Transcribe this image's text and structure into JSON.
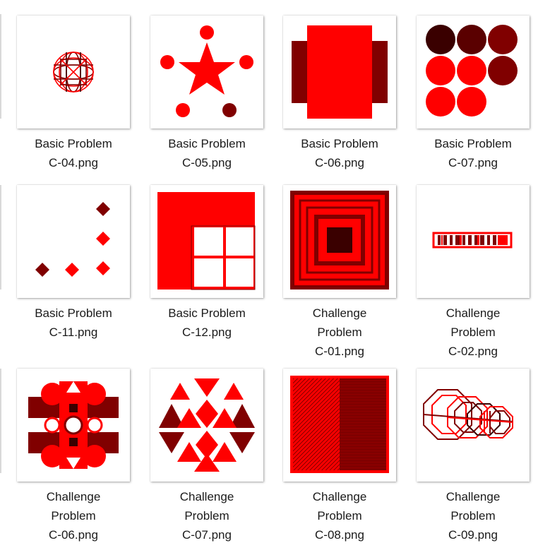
{
  "files": [
    {
      "line1": "Basic Problem",
      "line2": "C-04.png",
      "line3": "",
      "icon": "sphere-grid-image"
    },
    {
      "line1": "Basic Problem",
      "line2": "C-05.png",
      "line3": "",
      "icon": "star-circles-image"
    },
    {
      "line1": "Basic Problem",
      "line2": "C-06.png",
      "line3": "",
      "icon": "rectangles-image"
    },
    {
      "line1": "Basic Problem",
      "line2": "C-07.png",
      "line3": "",
      "icon": "circles-grid-image"
    },
    {
      "line1": "Basic Problem",
      "line2": "C-11.png",
      "line3": "",
      "icon": "diamonds-image"
    },
    {
      "line1": "Basic Problem",
      "line2": "C-12.png",
      "line3": "",
      "icon": "square-windows-image"
    },
    {
      "line1": "Challenge",
      "line2": "Problem",
      "line3": "C-01.png",
      "icon": "nested-squares-image"
    },
    {
      "line1": "Challenge",
      "line2": "Problem",
      "line3": "C-02.png",
      "icon": "barcode-strip-image"
    },
    {
      "line1": "Challenge",
      "line2": "Problem",
      "line3": "C-06.png",
      "icon": "circles-crosses-image"
    },
    {
      "line1": "Challenge",
      "line2": "Problem",
      "line3": "C-07.png",
      "icon": "triangles-diamonds-image"
    },
    {
      "line1": "Challenge",
      "line2": "Problem",
      "line3": "C-08.png",
      "icon": "hatched-square-image"
    },
    {
      "line1": "Challenge",
      "line2": "Problem",
      "line3": "C-09.png",
      "icon": "octagons-image"
    }
  ],
  "colors": {
    "red": "#ff0000",
    "dark_red": "#800000",
    "darkest": "#3a0000"
  }
}
